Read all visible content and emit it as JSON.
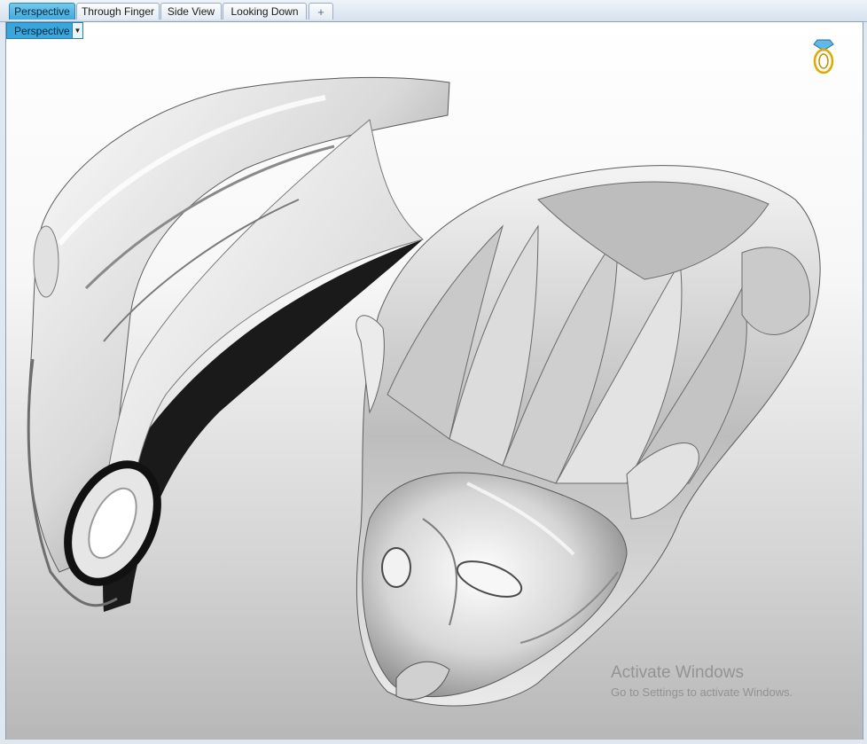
{
  "tabs": [
    {
      "label": "Perspective",
      "active": true
    },
    {
      "label": "Through Finger",
      "active": false
    },
    {
      "label": "Side View",
      "active": false
    },
    {
      "label": "Looking Down",
      "active": false
    }
  ],
  "add_tab_glyph": "+",
  "viewport": {
    "dropdown_label": "Perspective",
    "dropdown_arrow": "▼",
    "corner_icon": "ring-gem-icon"
  },
  "watermark": {
    "title": "Activate Windows",
    "subtitle": "Go to Settings to activate Windows."
  },
  "colors": {
    "active_tab": "#40a9dc",
    "tab_border": "#9aaec4",
    "icon_gold": "#e0a800"
  }
}
